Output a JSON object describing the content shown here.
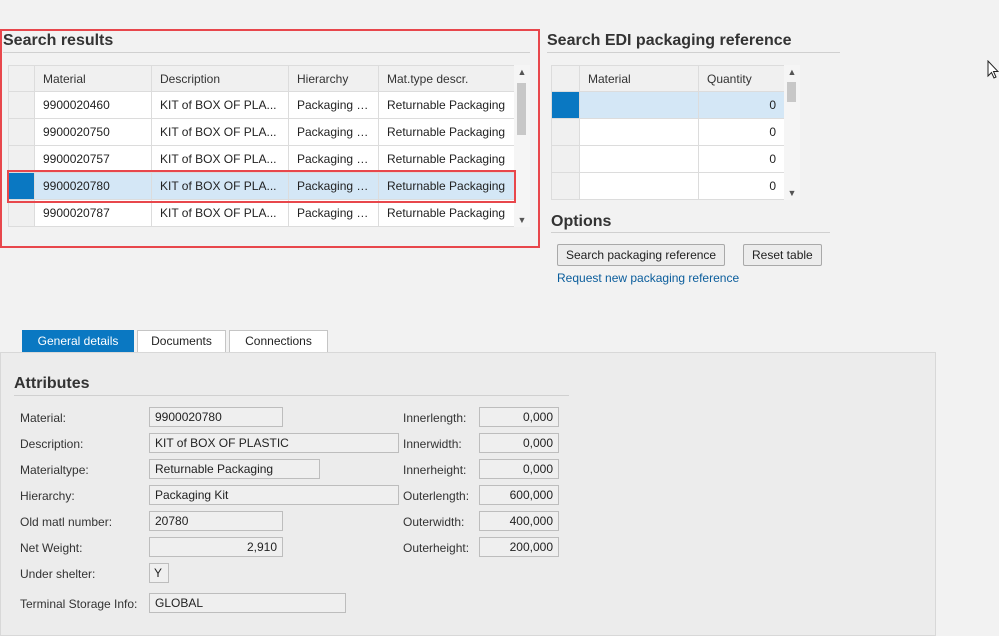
{
  "search_results": {
    "title": "Search results",
    "columns": [
      "Material",
      "Description",
      "Hierarchy",
      "Mat.type descr."
    ],
    "rows": [
      {
        "material": "9900020460",
        "description": "KIT of BOX OF PLA...",
        "hierarchy": "Packaging Kit",
        "mat_type": "Returnable Packaging"
      },
      {
        "material": "9900020750",
        "description": "KIT of BOX OF PLA...",
        "hierarchy": "Packaging Kit",
        "mat_type": "Returnable Packaging"
      },
      {
        "material": "9900020757",
        "description": "KIT of BOX OF PLA...",
        "hierarchy": "Packaging Kit",
        "mat_type": "Returnable Packaging"
      },
      {
        "material": "9900020780",
        "description": "KIT of BOX OF PLA...",
        "hierarchy": "Packaging Kit",
        "mat_type": "Returnable Packaging"
      },
      {
        "material": "9900020787",
        "description": "KIT of BOX OF PLA...",
        "hierarchy": "Packaging Kit",
        "mat_type": "Returnable Packaging"
      }
    ],
    "selected_row": 3
  },
  "edi_search": {
    "title": "Search EDI packaging reference",
    "columns": [
      "Material",
      "Quantity"
    ],
    "rows": [
      {
        "material": "",
        "quantity": "0"
      },
      {
        "material": "",
        "quantity": "0"
      },
      {
        "material": "",
        "quantity": "0"
      },
      {
        "material": "",
        "quantity": "0"
      }
    ]
  },
  "options": {
    "title": "Options",
    "search_button": "Search packaging reference",
    "reset_button": "Reset table",
    "request_link": "Request new packaging reference"
  },
  "tabs": [
    {
      "label": "General details",
      "active": true
    },
    {
      "label": "Documents",
      "active": false
    },
    {
      "label": "Connections",
      "active": false
    }
  ],
  "attributes": {
    "title": "Attributes",
    "left": [
      {
        "label": "Material:",
        "value": "9900020780"
      },
      {
        "label": "Description:",
        "value": "KIT of BOX OF PLASTIC"
      },
      {
        "label": "Materialtype:",
        "value": "Returnable Packaging"
      },
      {
        "label": "Hierarchy:",
        "value": "Packaging Kit"
      },
      {
        "label": "Old matl number:",
        "value": "20780"
      },
      {
        "label": "Net Weight:",
        "value": "2,910"
      },
      {
        "label": "Under shelter:",
        "value": "Y"
      },
      {
        "label": "Terminal Storage Info:",
        "value": "GLOBAL"
      }
    ],
    "right": [
      {
        "label": "Innerlength:",
        "value": "0,000"
      },
      {
        "label": "Innerwidth:",
        "value": "0,000"
      },
      {
        "label": "Innerheight:",
        "value": "0,000"
      },
      {
        "label": "Outerlength:",
        "value": "600,000"
      },
      {
        "label": "Outerwidth:",
        "value": "400,000"
      },
      {
        "label": "Outerheight:",
        "value": "200,000"
      }
    ]
  }
}
